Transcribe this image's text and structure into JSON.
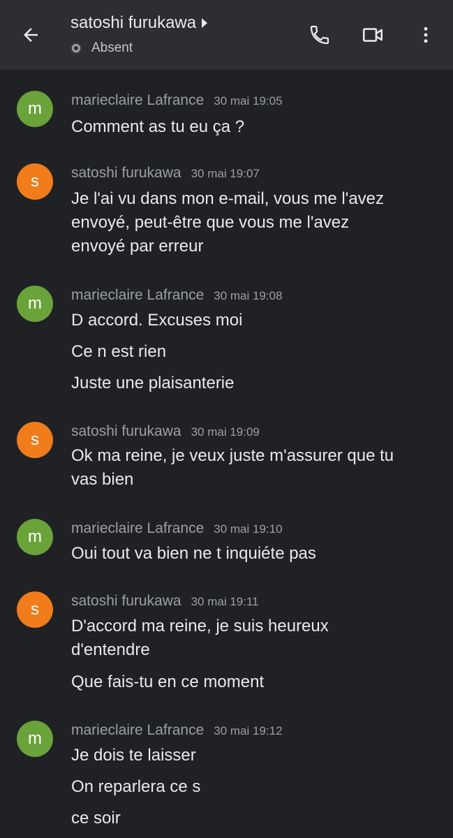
{
  "header": {
    "title": "satoshi furukawa",
    "status": "Absent"
  },
  "messages": [
    {
      "avatar_letter": "m",
      "sender": "marieclaire Lafrance",
      "time": "30 mai 19:05",
      "lines": [
        "Comment as tu eu ça ?"
      ]
    },
    {
      "avatar_letter": "s",
      "sender": "satoshi furukawa",
      "time": "30 mai 19:07",
      "lines": [
        "Je l'ai vu dans mon e-mail, vous me l'avez",
        "envoyé, peut-être que vous me l'avez",
        "envoyé par erreur"
      ]
    },
    {
      "avatar_letter": "m",
      "sender": "marieclaire Lafrance",
      "time": "30 mai 19:08",
      "lines": [
        "D accord. Excuses moi",
        "Ce n est rien",
        "Juste une plaisanterie"
      ]
    },
    {
      "avatar_letter": "s",
      "sender": "satoshi furukawa",
      "time": "30 mai 19:09",
      "lines": [
        "Ok ma reine, je veux juste m'assurer que tu",
        "vas bien"
      ]
    },
    {
      "avatar_letter": "m",
      "sender": "marieclaire Lafrance",
      "time": "30 mai 19:10",
      "lines": [
        "Oui tout va bien ne t inquiéte pas"
      ]
    },
    {
      "avatar_letter": "s",
      "sender": "satoshi furukawa",
      "time": "30 mai 19:11",
      "lines": [
        "D'accord ma reine, je suis heureux",
        "d'entendre",
        "Que fais-tu en ce moment"
      ]
    },
    {
      "avatar_letter": "m",
      "sender": "marieclaire Lafrance",
      "time": "30 mai 19:12",
      "lines": [
        "Je dois te laisser",
        "On reparlera ce s",
        "ce soir"
      ]
    }
  ],
  "colors": {
    "background": "#202124",
    "header": "#2d2e31",
    "avatar_m": "#6aa33a",
    "avatar_s": "#f07c1b",
    "text": "#e8eaed",
    "muted": "#9aa0a6"
  },
  "icons": {
    "back": "arrow-left-icon",
    "call": "phone-icon",
    "video": "video-camera-icon",
    "more": "more-vertical-icon",
    "status": "absent-status-icon"
  }
}
